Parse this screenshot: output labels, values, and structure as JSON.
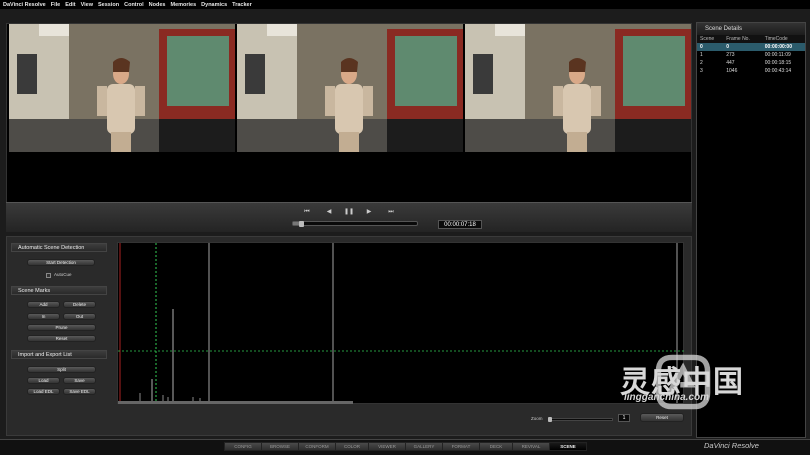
{
  "menubar": {
    "app_name": "DaVinci Resolve",
    "items": [
      "File",
      "Edit",
      "View",
      "Session",
      "Control",
      "Nodes",
      "Memories",
      "Dynamics",
      "Tracker"
    ]
  },
  "transport": {
    "timecode": "00:00:07:18",
    "icons": [
      "skip-to-start-icon",
      "step-back-icon",
      "pause-icon",
      "play-icon",
      "skip-to-end-icon"
    ],
    "progress": 0.05
  },
  "scene_details": {
    "title": "Scene Details",
    "columns": [
      "Scene",
      "Frame No.",
      "TimeCode"
    ],
    "rows": [
      [
        "0",
        "0",
        "00:00:00:00"
      ],
      [
        "1",
        "273",
        "00:00:11:09"
      ],
      [
        "2",
        "447",
        "00:00:18:15"
      ],
      [
        "3",
        "1046",
        "00:00:43:14"
      ]
    ]
  },
  "auto_detect": {
    "heading": "Automatic Scene Detection",
    "start_label": "Start Detection",
    "autocue_label": "AutoCue"
  },
  "scene_marks": {
    "heading": "Scene Marks",
    "add": "Add",
    "delete": "Delete",
    "in": "In",
    "out": "Out",
    "prune": "Prune",
    "reset": "Reset"
  },
  "import_export": {
    "heading": "Import and Export List",
    "split": "Split",
    "load": "Load",
    "save": "Save",
    "load_edl": "Load EDL",
    "save_edl": "Save EDL"
  },
  "zoom": {
    "label": "Zoom",
    "value": "1",
    "reset": "Reset",
    "level": 0.0
  },
  "pages": [
    "CONFIG",
    "BROWSE",
    "CONFORM",
    "COLOR",
    "VIEWER",
    "GALLERY",
    "FORMAT",
    "DECK",
    "REVIVAL",
    "SCENE"
  ],
  "active_page": "SCENE",
  "brand": "DaVinci Resolve",
  "watermark": {
    "text": "灵感中国",
    "sub": "lingganchina.com"
  },
  "colors": {
    "selection": "#2b5b6b",
    "threshold_line": "#33cc55",
    "cut_line": "#cccccc"
  }
}
